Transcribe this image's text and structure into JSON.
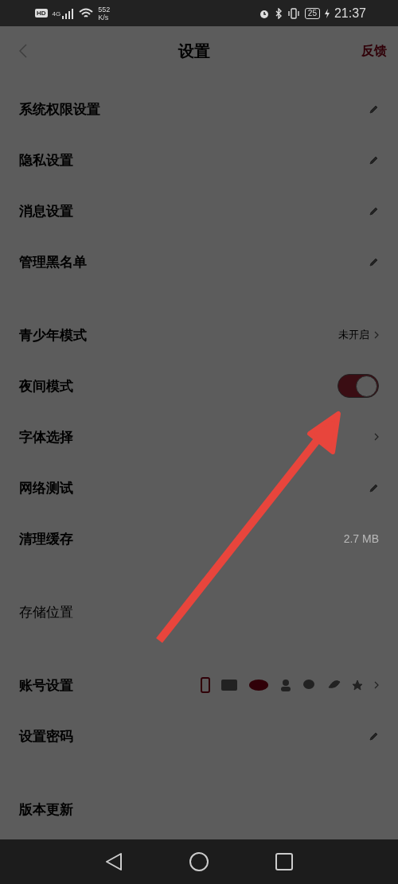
{
  "status_bar": {
    "hd": "HD",
    "network": "4G",
    "speed_value": "552",
    "speed_unit": "K/s",
    "battery": "25",
    "time": "21:37"
  },
  "header": {
    "title": "设置",
    "action": "反馈"
  },
  "sections": [
    {
      "rows": [
        {
          "kind": "link",
          "label": "系统权限设置",
          "disabled": false
        },
        {
          "kind": "link",
          "label": "隐私设置",
          "disabled": false
        },
        {
          "kind": "link",
          "label": "消息设置",
          "disabled": false
        },
        {
          "kind": "link",
          "label": "管理黑名单",
          "disabled": false
        }
      ]
    },
    {
      "rows": [
        {
          "kind": "value",
          "label": "青少年模式",
          "value": "未开启",
          "disabled": false
        },
        {
          "kind": "toggle",
          "label": "夜间模式",
          "on": true,
          "disabled": false
        },
        {
          "kind": "chevron",
          "label": "字体选择",
          "disabled": false
        },
        {
          "kind": "link",
          "label": "网络测试",
          "disabled": false
        },
        {
          "kind": "text",
          "label": "清理缓存",
          "value": "2.7 MB",
          "disabled": false
        }
      ]
    },
    {
      "rows": [
        {
          "kind": "plain",
          "label": "存储位置",
          "disabled": true
        }
      ]
    },
    {
      "rows": [
        {
          "kind": "accounts",
          "label": "账号设置",
          "disabled": false
        },
        {
          "kind": "link",
          "label": "设置密码",
          "disabled": false
        }
      ]
    },
    {
      "rows": [
        {
          "kind": "plain",
          "label": "版本更新",
          "disabled": false
        }
      ]
    }
  ]
}
